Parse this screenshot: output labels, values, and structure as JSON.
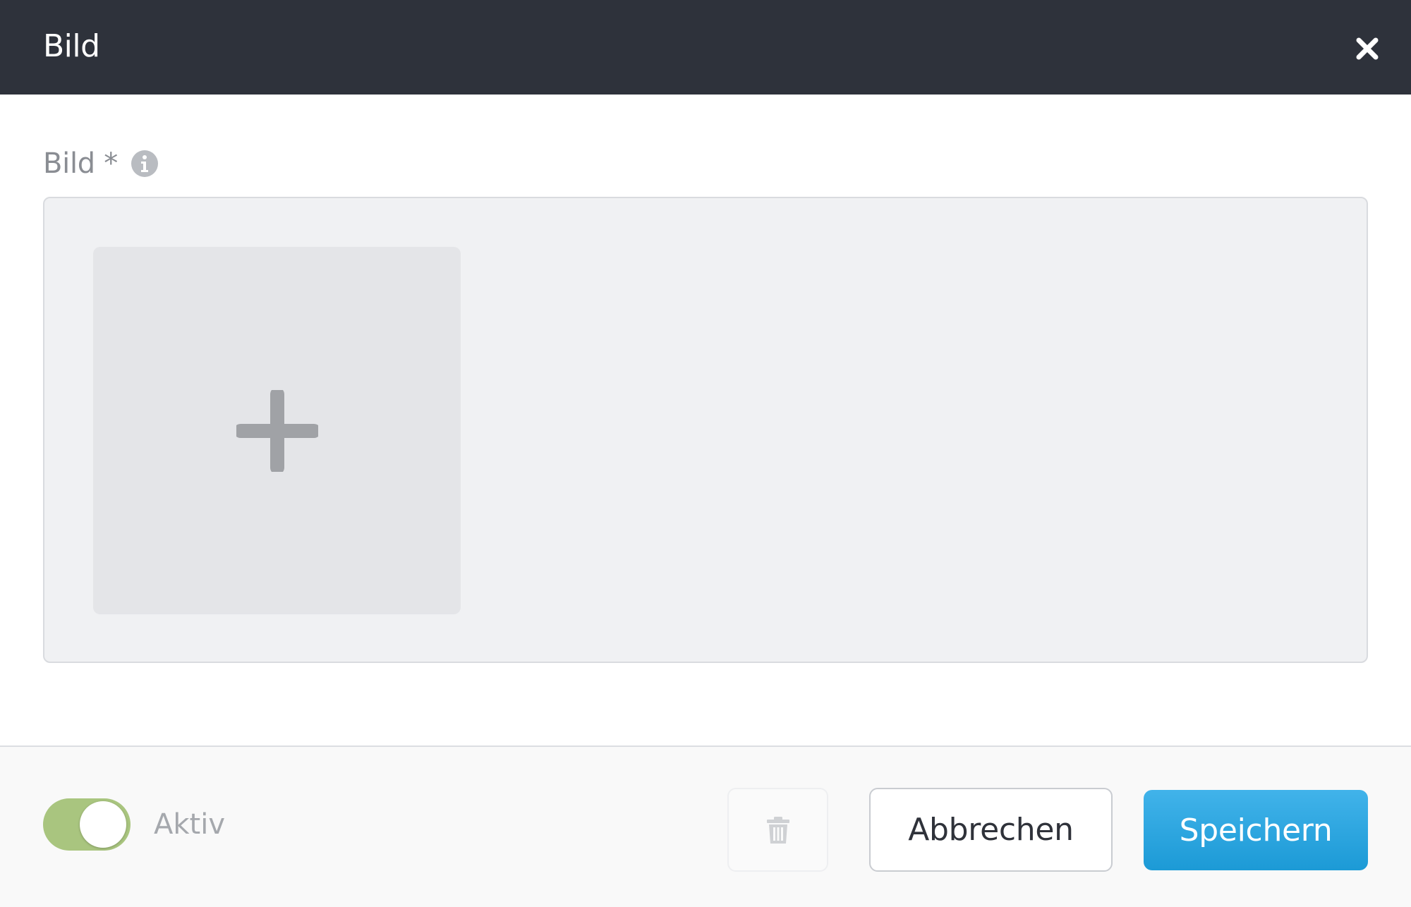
{
  "dialog": {
    "title": "Bild"
  },
  "field": {
    "label": "Bild *"
  },
  "footer": {
    "toggle_label": "Aktiv",
    "toggle_on": true,
    "cancel_label": "Abbrechen",
    "save_label": "Speichern"
  },
  "icons": {
    "close": "close-icon",
    "info": "info-icon",
    "add": "plus-icon",
    "delete": "trash-icon"
  },
  "colors": {
    "header_bg": "#2e323b",
    "primary": "#1c9ad6",
    "toggle_on": "#a9c57f"
  }
}
